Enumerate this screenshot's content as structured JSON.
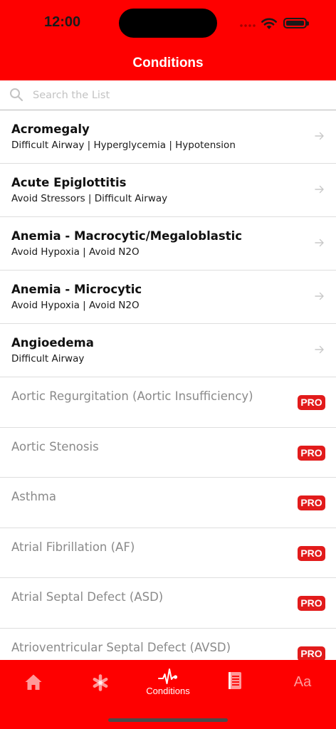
{
  "status_bar": {
    "time": "12:00"
  },
  "nav": {
    "title": "Conditions"
  },
  "search": {
    "placeholder": "Search the List",
    "value": ""
  },
  "list": {
    "free_items": [
      {
        "title": "Acromegaly",
        "subtitle": "Difficult Airway | Hyperglycemia | Hypotension"
      },
      {
        "title": "Acute Epiglottitis",
        "subtitle": "Avoid Stressors | Difficult Airway"
      },
      {
        "title": "Anemia - Macrocytic/Megaloblastic",
        "subtitle": "Avoid Hypoxia | Avoid N2O"
      },
      {
        "title": "Anemia - Microcytic",
        "subtitle": "Avoid Hypoxia | Avoid N2O"
      },
      {
        "title": "Angioedema",
        "subtitle": "Difficult Airway"
      }
    ],
    "pro_badge": "PRO",
    "pro_items": [
      {
        "title": "Aortic Regurgitation (Aortic Insufficiency)"
      },
      {
        "title": "Aortic Stenosis"
      },
      {
        "title": "Asthma"
      },
      {
        "title": "Atrial Fibrillation (AF)"
      },
      {
        "title": "Atrial Septal Defect (ASD)"
      },
      {
        "title": "Atrioventricular Septal Defect (AVSD)"
      }
    ]
  },
  "tabbar": {
    "tabs": [
      {
        "icon": "home-icon",
        "label": ""
      },
      {
        "icon": "asterisk-icon",
        "label": ""
      },
      {
        "icon": "heartbeat-icon",
        "label": "Conditions"
      },
      {
        "icon": "document-icon",
        "label": ""
      },
      {
        "icon": "text-size-icon",
        "label": "Aa"
      }
    ]
  },
  "colors": {
    "brand_red": "#fe0000",
    "pro_badge": "#e21b1b",
    "pro_text": "#8a8a8a"
  }
}
